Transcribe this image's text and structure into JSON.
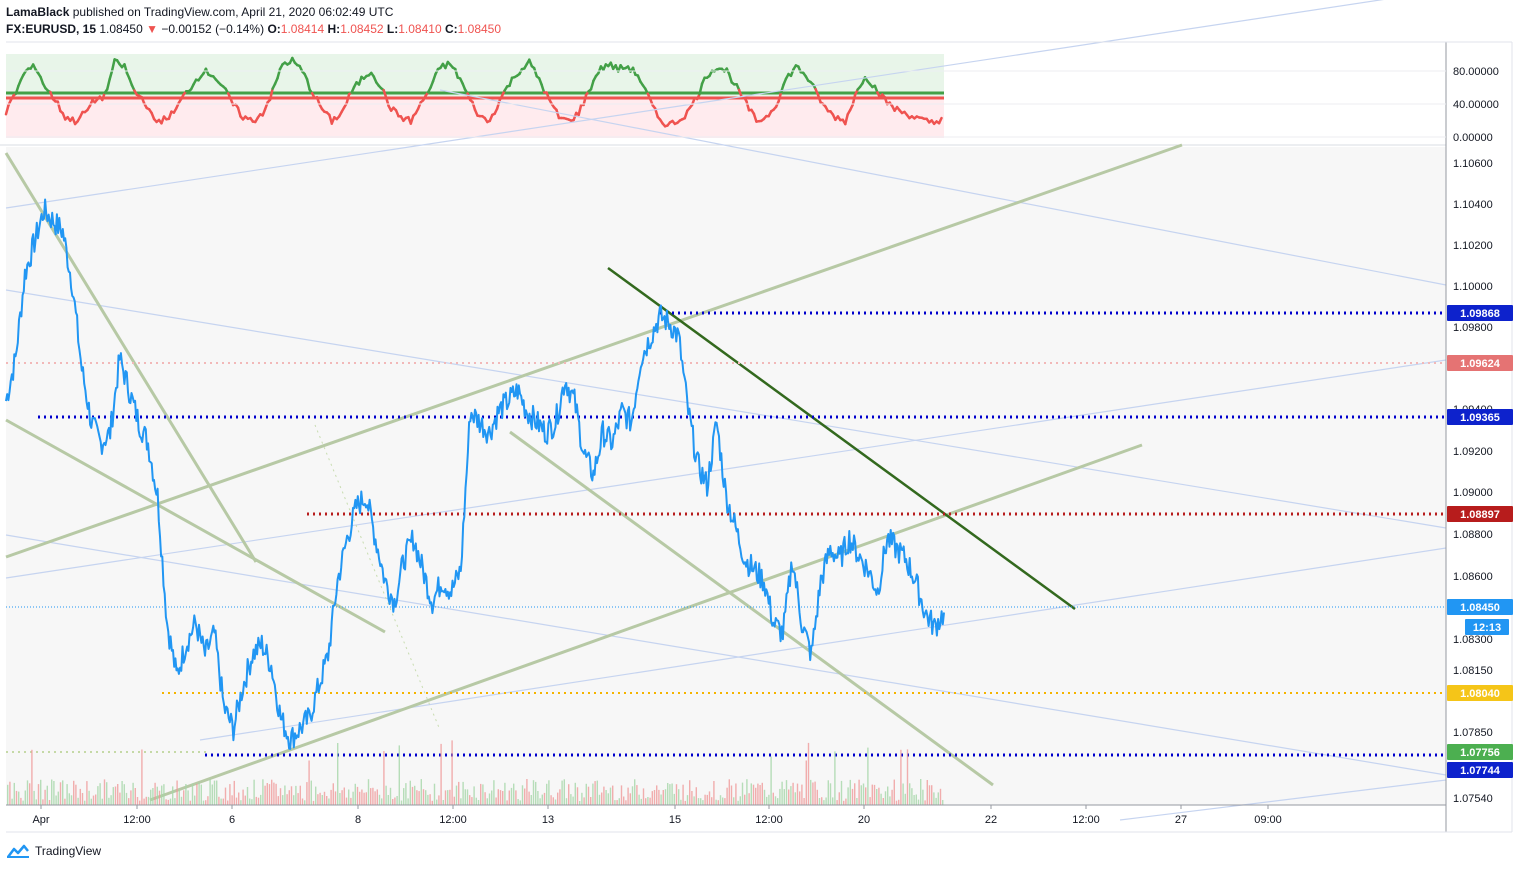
{
  "header": {
    "author": "LamaBlack",
    "published_text": "published on TradingView.com, April 21, 2020 06:02:49 UTC",
    "symbol": "FX:EURUSD, 15",
    "last_price": "1.08450",
    "change_arrow": "▼",
    "change": "−0.00152 (−0.14%)",
    "o_label": "O:",
    "o_value": "1.08414",
    "h_label": "H:",
    "h_value": "1.08452",
    "l_label": "L:",
    "l_value": "1.08410",
    "c_label": "C:",
    "c_value": "1.08450"
  },
  "footer": {
    "brand": "TradingView"
  },
  "colors": {
    "price_line": "#2196f3",
    "osc_green": "#43a047",
    "osc_red": "#ef5350",
    "trend_green": "#33691e",
    "channel": "#b7c9a5",
    "blue_level": "#0000cc",
    "red_level": "#b71c1c",
    "orange_level": "#f5b400"
  },
  "chart_data": [
    {
      "type": "line",
      "title": "FX:EURUSD, 15",
      "xlabel": "",
      "ylabel": "",
      "x_tick_labels": [
        "Apr",
        "12:00",
        "6",
        "8",
        "12:00",
        "13",
        "15",
        "12:00",
        "20",
        "22",
        "12:00",
        "27",
        "09:00"
      ],
      "y_tick_labels": [
        "1.10600",
        "1.10400",
        "1.10200",
        "1.10000",
        "1.09800",
        "1.09400",
        "1.09200",
        "1.09000",
        "1.08800",
        "1.08600",
        "1.08300",
        "1.08150",
        "1.07850",
        "1.07540"
      ],
      "ylim": [
        1.0754,
        1.1065
      ],
      "grid": false,
      "series": [
        {
          "values": [
            1.0945,
            1.0965,
            1.1005,
            1.102,
            1.1035,
            1.103,
            1.1025,
            1.1,
            1.096,
            1.0935,
            1.0925,
            1.093,
            1.0965,
            1.095,
            1.0935,
            1.0925,
            1.09,
            1.084,
            1.0815,
            1.083,
            1.084,
            1.0825,
            1.0835,
            1.08,
            1.079,
            1.081,
            1.0825,
            1.083,
            1.082,
            1.0795,
            1.0785,
            1.079,
            1.0795,
            1.081,
            1.0825,
            1.086,
            1.088,
            1.0895,
            1.09,
            1.088,
            1.086,
            1.085,
            1.087,
            1.088,
            1.0865,
            1.085,
            1.086,
            1.0855,
            1.0865,
            1.094,
            1.0935,
            1.093,
            1.094,
            1.0945,
            1.095,
            1.094,
            1.0935,
            1.093,
            1.0935,
            1.0955,
            1.0945,
            1.092,
            1.091,
            1.093,
            1.0925,
            1.094,
            1.0935,
            1.0965,
            1.0975,
            1.0985,
            1.0982,
            1.0975,
            1.094,
            1.0915,
            1.0905,
            1.0935,
            1.09,
            1.0885,
            1.087,
            1.0865,
            1.086,
            1.084,
            1.0835,
            1.087,
            1.084,
            1.0825,
            1.086,
            1.0875,
            1.087,
            1.088,
            1.0872,
            1.0865,
            1.0855,
            1.088,
            1.0875,
            1.087,
            1.086,
            1.0845,
            1.0838,
            1.0845
          ]
        }
      ],
      "horizontal_levels": [
        {
          "value": "1.09868",
          "style": "blue-dotted"
        },
        {
          "value": "1.09624",
          "style": "pink-dotted"
        },
        {
          "value": "1.09365",
          "style": "blue-dotted"
        },
        {
          "value": "1.08897",
          "style": "red-dotted"
        },
        {
          "value": "1.08450",
          "style": "current-price"
        },
        {
          "value": "1.08040",
          "style": "orange-dotted"
        },
        {
          "value": "1.07756",
          "style": "green-dotted"
        },
        {
          "value": "1.07744",
          "style": "blue-dotted"
        }
      ],
      "countdown": "12:13"
    },
    {
      "type": "line",
      "title": "",
      "y_tick_labels": [
        "80.00000",
        "40.00000",
        "0.00000"
      ],
      "ylim": [
        0,
        100
      ],
      "levels": [
        55,
        48
      ],
      "series": [
        {
          "values": [
            30,
            55,
            80,
            85,
            60,
            45,
            25,
            20,
            30,
            45,
            50,
            90,
            85,
            55,
            45,
            20,
            22,
            30,
            50,
            65,
            80,
            75,
            60,
            40,
            25,
            20,
            30,
            55,
            88,
            92,
            80,
            55,
            35,
            20,
            30,
            55,
            70,
            80,
            60,
            35,
            25,
            20,
            40,
            60,
            85,
            88,
            70,
            45,
            25,
            20,
            45,
            65,
            80,
            90,
            70,
            45,
            25,
            20,
            30,
            55,
            80,
            88,
            82,
            85,
            75,
            50,
            25,
            15,
            20,
            30,
            50,
            75,
            85,
            80,
            60,
            40,
            20,
            25,
            40,
            70,
            85,
            75,
            55,
            35,
            25,
            20,
            50,
            75,
            60,
            45,
            35,
            30,
            25,
            20,
            18,
            25
          ]
        }
      ]
    }
  ],
  "y_axis": {
    "main_badges": [
      {
        "text": "1.09868",
        "color": "#0d22cc"
      },
      {
        "text": "1.09624",
        "color": "#e57373"
      },
      {
        "text": "1.09365",
        "color": "#0d22cc"
      },
      {
        "text": "1.08897",
        "color": "#b71c1c"
      },
      {
        "text": "1.08450",
        "color": "#2196f3"
      },
      {
        "text": "12:13",
        "color": "#2196f3"
      },
      {
        "text": "1.08040",
        "color": "#f5c518"
      },
      {
        "text": "1.07756",
        "color": "#4caf50"
      },
      {
        "text": "1.07744",
        "color": "#0d22cc"
      }
    ]
  }
}
